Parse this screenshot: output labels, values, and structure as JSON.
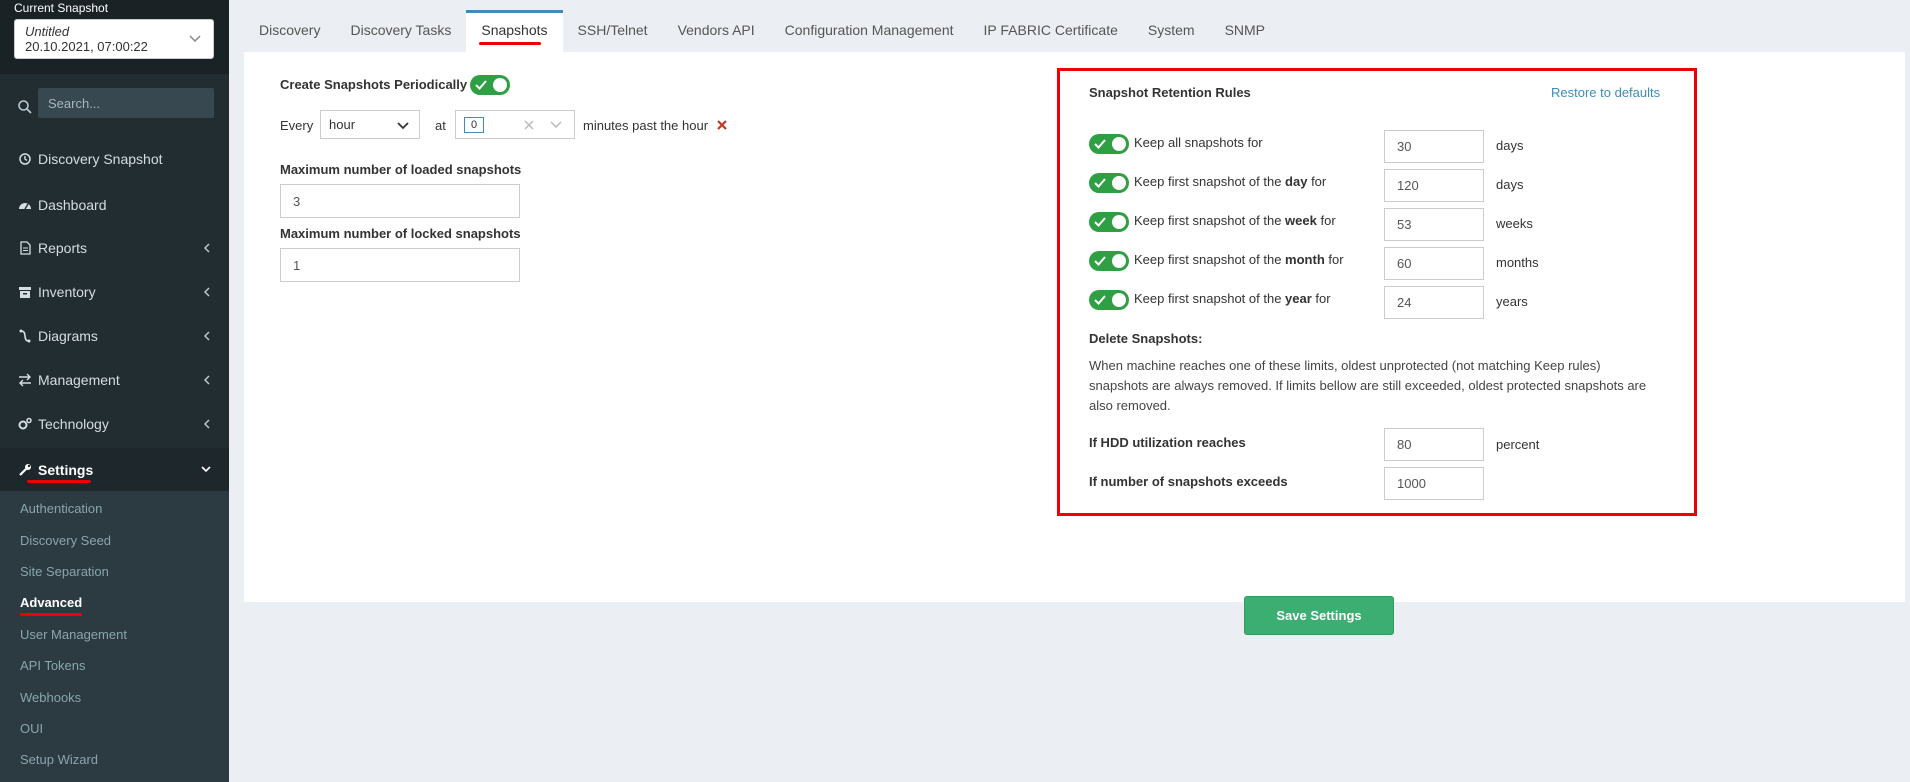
{
  "sidebar": {
    "snapshot_header": "Current Snapshot",
    "snapshot_name": "Untitled",
    "snapshot_date": "20.10.2021, 07:00:22",
    "search_placeholder": "Search...",
    "nav": [
      {
        "label": "Discovery Snapshot",
        "icon": "history-icon"
      },
      {
        "label": "Dashboard",
        "icon": "dashboard-icon"
      },
      {
        "label": "Reports",
        "icon": "file-icon"
      },
      {
        "label": "Inventory",
        "icon": "archive-icon"
      },
      {
        "label": "Diagrams",
        "icon": "diagram-icon"
      },
      {
        "label": "Management",
        "icon": "exchange-icon"
      },
      {
        "label": "Technology",
        "icon": "cogs-icon"
      },
      {
        "label": "Settings",
        "icon": "wrench-icon"
      }
    ],
    "submenu": [
      "Authentication",
      "Discovery Seed",
      "Site Separation",
      "Advanced",
      "User Management",
      "API Tokens",
      "Webhooks",
      "OUI",
      "Setup Wizard"
    ]
  },
  "tabs": [
    "Discovery",
    "Discovery Tasks",
    "Snapshots",
    "SSH/Telnet",
    "Vendors API",
    "Configuration Management",
    "IP FABRIC Certificate",
    "System",
    "SNMP"
  ],
  "periodic": {
    "label": "Create Snapshots Periodically",
    "every_label": "Every",
    "every_value": "hour",
    "at_label": "at",
    "at_value": "0",
    "suffix": "minutes past the hour"
  },
  "max_loaded": {
    "label": "Maximum number of loaded snapshots",
    "value": "3"
  },
  "max_locked": {
    "label": "Maximum number of locked snapshots",
    "value": "1"
  },
  "retention": {
    "title": "Snapshot Retention Rules",
    "restore_label": "Restore to defaults",
    "rules": [
      {
        "pre": "Keep all snapshots for",
        "bold": "",
        "post": "",
        "value": "30",
        "unit": "days"
      },
      {
        "pre": "Keep first snapshot of the ",
        "bold": "day",
        "post": " for",
        "value": "120",
        "unit": "days"
      },
      {
        "pre": "Keep first snapshot of the ",
        "bold": "week",
        "post": " for",
        "value": "53",
        "unit": "weeks"
      },
      {
        "pre": "Keep first snapshot of the ",
        "bold": "month",
        "post": " for",
        "value": "60",
        "unit": "months"
      },
      {
        "pre": "Keep first snapshot of the ",
        "bold": "year",
        "post": " for",
        "value": "24",
        "unit": "years"
      }
    ],
    "delete_title": "Delete Snapshots:",
    "delete_desc": "When machine reaches one of these limits, oldest unprotected (not matching Keep rules) snapshots are always removed. If limits bellow are still exceeded, oldest protected snapshots are also removed.",
    "hdd_label": "If HDD utilization reaches",
    "hdd_value": "80",
    "hdd_unit": "percent",
    "count_label": "If number of snapshots exceeds",
    "count_value": "1000"
  },
  "save_label": "Save Settings",
  "colors": {
    "accent": "#3c8dbc",
    "toggle": "#2ea043",
    "highlight": "#ee0000",
    "save": "#3cae72"
  }
}
